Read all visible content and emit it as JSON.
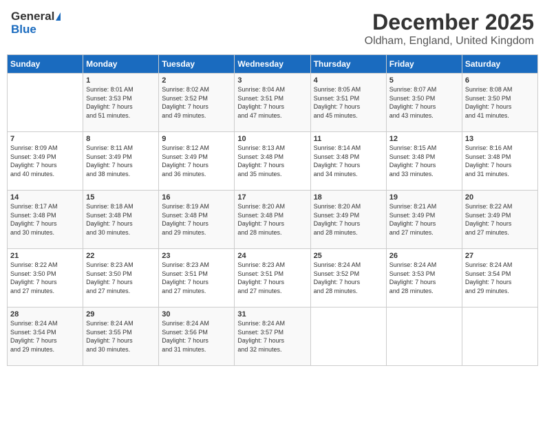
{
  "header": {
    "logo_general": "General",
    "logo_blue": "Blue",
    "title": "December 2025",
    "location": "Oldham, England, United Kingdom"
  },
  "days_of_week": [
    "Sunday",
    "Monday",
    "Tuesday",
    "Wednesday",
    "Thursday",
    "Friday",
    "Saturday"
  ],
  "weeks": [
    [
      {
        "day": "",
        "sunrise": "",
        "sunset": "",
        "daylight": ""
      },
      {
        "day": "1",
        "sunrise": "Sunrise: 8:01 AM",
        "sunset": "Sunset: 3:53 PM",
        "daylight": "Daylight: 7 hours and 51 minutes."
      },
      {
        "day": "2",
        "sunrise": "Sunrise: 8:02 AM",
        "sunset": "Sunset: 3:52 PM",
        "daylight": "Daylight: 7 hours and 49 minutes."
      },
      {
        "day": "3",
        "sunrise": "Sunrise: 8:04 AM",
        "sunset": "Sunset: 3:51 PM",
        "daylight": "Daylight: 7 hours and 47 minutes."
      },
      {
        "day": "4",
        "sunrise": "Sunrise: 8:05 AM",
        "sunset": "Sunset: 3:51 PM",
        "daylight": "Daylight: 7 hours and 45 minutes."
      },
      {
        "day": "5",
        "sunrise": "Sunrise: 8:07 AM",
        "sunset": "Sunset: 3:50 PM",
        "daylight": "Daylight: 7 hours and 43 minutes."
      },
      {
        "day": "6",
        "sunrise": "Sunrise: 8:08 AM",
        "sunset": "Sunset: 3:50 PM",
        "daylight": "Daylight: 7 hours and 41 minutes."
      }
    ],
    [
      {
        "day": "7",
        "sunrise": "Sunrise: 8:09 AM",
        "sunset": "Sunset: 3:49 PM",
        "daylight": "Daylight: 7 hours and 40 minutes."
      },
      {
        "day": "8",
        "sunrise": "Sunrise: 8:11 AM",
        "sunset": "Sunset: 3:49 PM",
        "daylight": "Daylight: 7 hours and 38 minutes."
      },
      {
        "day": "9",
        "sunrise": "Sunrise: 8:12 AM",
        "sunset": "Sunset: 3:49 PM",
        "daylight": "Daylight: 7 hours and 36 minutes."
      },
      {
        "day": "10",
        "sunrise": "Sunrise: 8:13 AM",
        "sunset": "Sunset: 3:48 PM",
        "daylight": "Daylight: 7 hours and 35 minutes."
      },
      {
        "day": "11",
        "sunrise": "Sunrise: 8:14 AM",
        "sunset": "Sunset: 3:48 PM",
        "daylight": "Daylight: 7 hours and 34 minutes."
      },
      {
        "day": "12",
        "sunrise": "Sunrise: 8:15 AM",
        "sunset": "Sunset: 3:48 PM",
        "daylight": "Daylight: 7 hours and 33 minutes."
      },
      {
        "day": "13",
        "sunrise": "Sunrise: 8:16 AM",
        "sunset": "Sunset: 3:48 PM",
        "daylight": "Daylight: 7 hours and 31 minutes."
      }
    ],
    [
      {
        "day": "14",
        "sunrise": "Sunrise: 8:17 AM",
        "sunset": "Sunset: 3:48 PM",
        "daylight": "Daylight: 7 hours and 30 minutes."
      },
      {
        "day": "15",
        "sunrise": "Sunrise: 8:18 AM",
        "sunset": "Sunset: 3:48 PM",
        "daylight": "Daylight: 7 hours and 30 minutes."
      },
      {
        "day": "16",
        "sunrise": "Sunrise: 8:19 AM",
        "sunset": "Sunset: 3:48 PM",
        "daylight": "Daylight: 7 hours and 29 minutes."
      },
      {
        "day": "17",
        "sunrise": "Sunrise: 8:20 AM",
        "sunset": "Sunset: 3:48 PM",
        "daylight": "Daylight: 7 hours and 28 minutes."
      },
      {
        "day": "18",
        "sunrise": "Sunrise: 8:20 AM",
        "sunset": "Sunset: 3:49 PM",
        "daylight": "Daylight: 7 hours and 28 minutes."
      },
      {
        "day": "19",
        "sunrise": "Sunrise: 8:21 AM",
        "sunset": "Sunset: 3:49 PM",
        "daylight": "Daylight: 7 hours and 27 minutes."
      },
      {
        "day": "20",
        "sunrise": "Sunrise: 8:22 AM",
        "sunset": "Sunset: 3:49 PM",
        "daylight": "Daylight: 7 hours and 27 minutes."
      }
    ],
    [
      {
        "day": "21",
        "sunrise": "Sunrise: 8:22 AM",
        "sunset": "Sunset: 3:50 PM",
        "daylight": "Daylight: 7 hours and 27 minutes."
      },
      {
        "day": "22",
        "sunrise": "Sunrise: 8:23 AM",
        "sunset": "Sunset: 3:50 PM",
        "daylight": "Daylight: 7 hours and 27 minutes."
      },
      {
        "day": "23",
        "sunrise": "Sunrise: 8:23 AM",
        "sunset": "Sunset: 3:51 PM",
        "daylight": "Daylight: 7 hours and 27 minutes."
      },
      {
        "day": "24",
        "sunrise": "Sunrise: 8:23 AM",
        "sunset": "Sunset: 3:51 PM",
        "daylight": "Daylight: 7 hours and 27 minutes."
      },
      {
        "day": "25",
        "sunrise": "Sunrise: 8:24 AM",
        "sunset": "Sunset: 3:52 PM",
        "daylight": "Daylight: 7 hours and 28 minutes."
      },
      {
        "day": "26",
        "sunrise": "Sunrise: 8:24 AM",
        "sunset": "Sunset: 3:53 PM",
        "daylight": "Daylight: 7 hours and 28 minutes."
      },
      {
        "day": "27",
        "sunrise": "Sunrise: 8:24 AM",
        "sunset": "Sunset: 3:54 PM",
        "daylight": "Daylight: 7 hours and 29 minutes."
      }
    ],
    [
      {
        "day": "28",
        "sunrise": "Sunrise: 8:24 AM",
        "sunset": "Sunset: 3:54 PM",
        "daylight": "Daylight: 7 hours and 29 minutes."
      },
      {
        "day": "29",
        "sunrise": "Sunrise: 8:24 AM",
        "sunset": "Sunset: 3:55 PM",
        "daylight": "Daylight: 7 hours and 30 minutes."
      },
      {
        "day": "30",
        "sunrise": "Sunrise: 8:24 AM",
        "sunset": "Sunset: 3:56 PM",
        "daylight": "Daylight: 7 hours and 31 minutes."
      },
      {
        "day": "31",
        "sunrise": "Sunrise: 8:24 AM",
        "sunset": "Sunset: 3:57 PM",
        "daylight": "Daylight: 7 hours and 32 minutes."
      },
      {
        "day": "",
        "sunrise": "",
        "sunset": "",
        "daylight": ""
      },
      {
        "day": "",
        "sunrise": "",
        "sunset": "",
        "daylight": ""
      },
      {
        "day": "",
        "sunrise": "",
        "sunset": "",
        "daylight": ""
      }
    ]
  ]
}
